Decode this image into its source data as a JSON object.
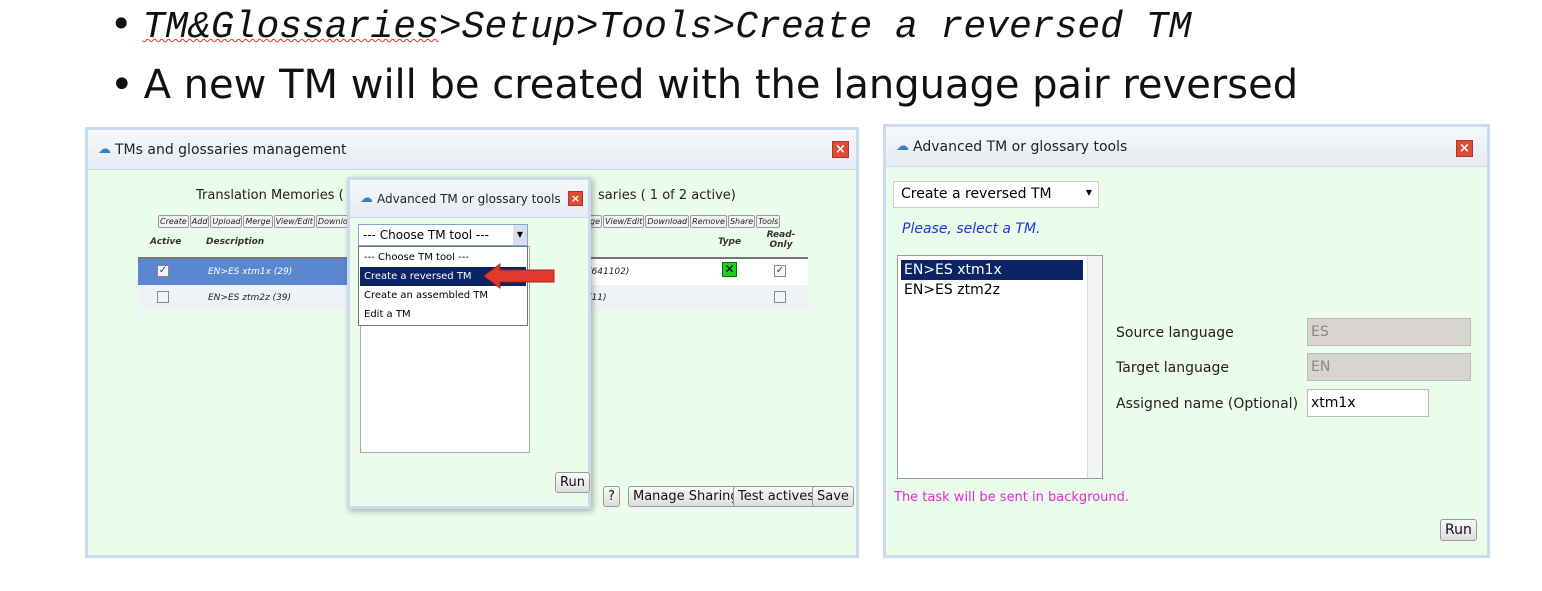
{
  "slide": {
    "bullet_path": "TM&Glossaries>Setup>Tools>Create a reversed TM",
    "bullet_path_underlined": "TM&Glossaries",
    "bullet_path_rest": ">Setup>Tools>Create a reversed TM",
    "bullet_desc": "A new TM will be created with the language pair reversed",
    "bullet_char": "•"
  },
  "main_window": {
    "title": "TMs and glossaries management",
    "tm_header": "Translation Memories ( 1 of 2 active)",
    "tm_header_visible": "Translation Memories ( 1 (",
    "tm_buttons": [
      "Create",
      "Add",
      "Upload",
      "Merge",
      "View/Edit",
      "Downlo"
    ],
    "gl_header_visible": "saries ( 1 of 2 active)",
    "gl_buttons": [
      "ge",
      "View/Edit",
      "Download",
      "Remove",
      "Share",
      "Tools"
    ],
    "columns": {
      "active": "Active",
      "description": "Description",
      "type": "Type",
      "read_only": "Read-Only"
    },
    "tm_rows": [
      {
        "active": true,
        "description": "EN>ES xtm1x (29)",
        "selected": true
      },
      {
        "active": false,
        "description": "EN>ES ztm2z (39)",
        "selected": false
      }
    ],
    "gl_rows": [
      {
        "count": "(641102)",
        "read_only": true,
        "type_icon": "glossary-type-icon"
      },
      {
        "count": "(11)",
        "read_only": false
      }
    ],
    "footer_buttons": [
      "?",
      "Manage Sharing",
      "Test actives",
      "Save"
    ]
  },
  "small_dialog": {
    "title": "Advanced TM or glossary tools",
    "select_value": "--- Choose TM tool ---",
    "options": [
      "--- Choose TM tool ---",
      "Create a reversed TM",
      "Create an assembled TM",
      "Edit a TM"
    ],
    "highlighted_option": "Create a reversed TM",
    "run_label": "Run",
    "arrow_color": "#e03a2e"
  },
  "big_dialog": {
    "title": "Advanced TM or glossary tools",
    "select_value": "Create a reversed TM",
    "prompt": "Please, select a TM.",
    "tm_list": [
      "EN>ES xtm1x",
      "EN>ES ztm2z"
    ],
    "selected_tm": "EN>ES xtm1x",
    "source_label": "Source language",
    "source_value": "ES",
    "target_label": "Target language",
    "target_value": "EN",
    "name_label": "Assigned name (Optional)",
    "name_value": "xtm1x",
    "background_note": "The task will be sent in background.",
    "run_label": "Run"
  },
  "colors": {
    "body_green": "#eafcea",
    "selected_row": "#5b87d0",
    "highlight": "#0a2466",
    "prompt_blue": "#2233dd",
    "note_magenta": "#ee22dd"
  }
}
